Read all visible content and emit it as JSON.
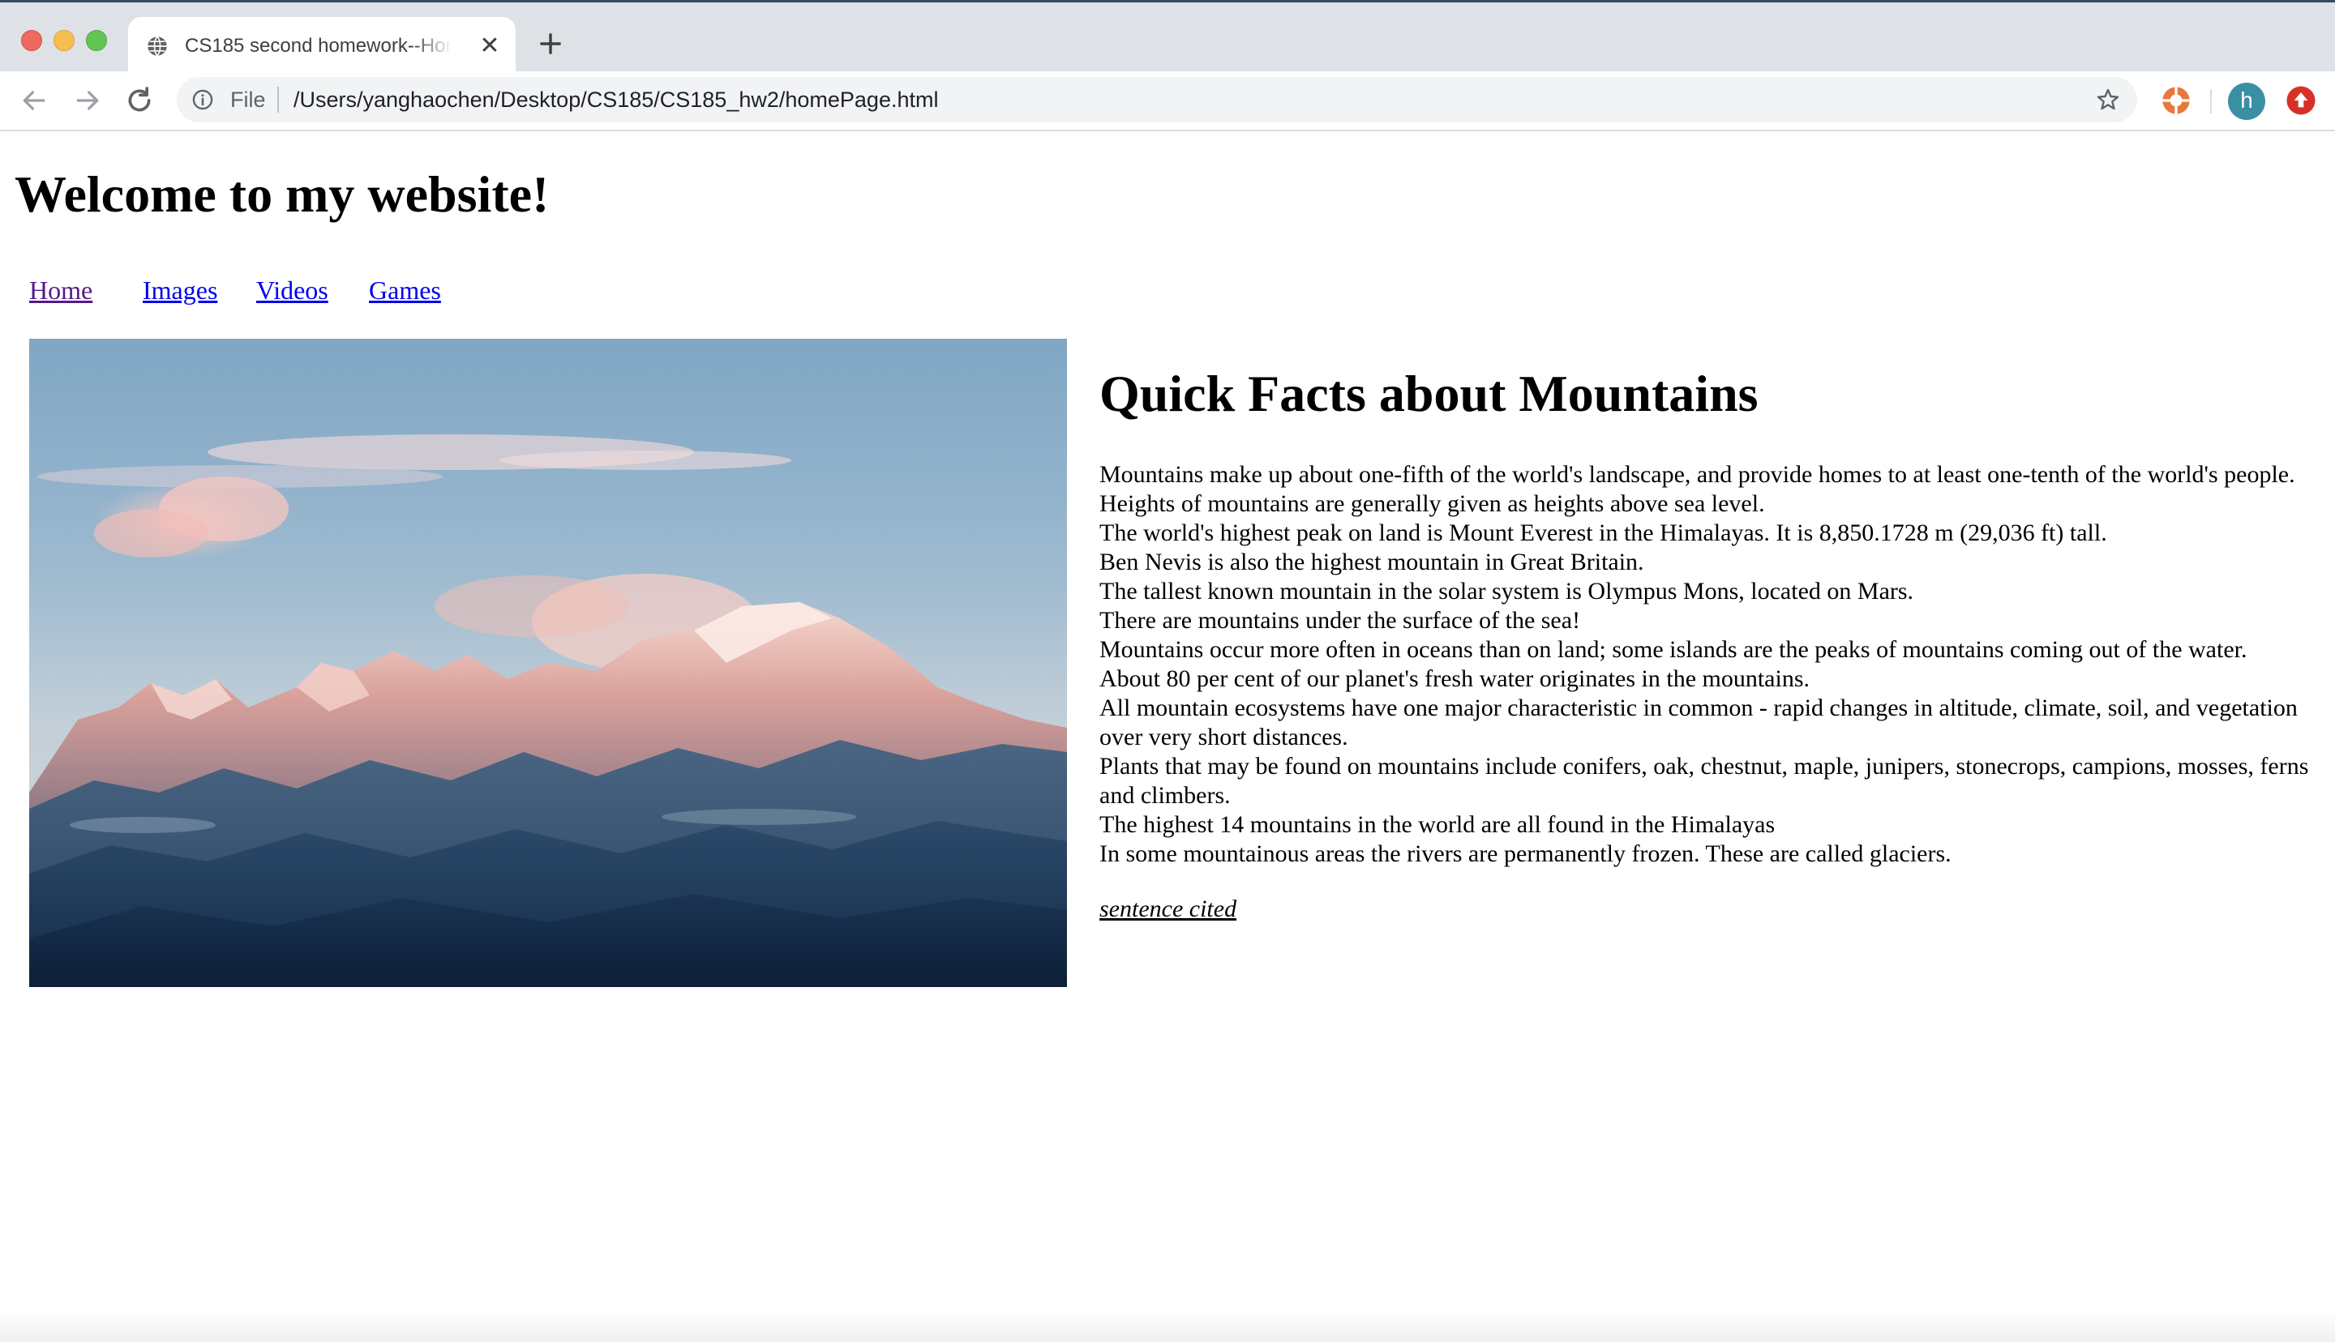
{
  "browser": {
    "window_controls": [
      "close",
      "minimize",
      "zoom"
    ],
    "tab": {
      "title": "CS185 second homework--Home",
      "favicon": "globe-icon",
      "close_icon": "close-icon"
    },
    "new_tab_icon": "plus-icon",
    "toolbar": {
      "back_icon": "arrow-left-icon",
      "forward_icon": "arrow-right-icon",
      "reload_icon": "reload-icon",
      "info_icon": "info-icon",
      "scheme_label": "File",
      "url": "/Users/yanghaochen/Desktop/CS185/CS185_hw2/homePage.html",
      "bookmark_icon": "star-icon",
      "extension_icon": "extension-icon",
      "profile_initial": "h",
      "update_icon": "update-icon"
    },
    "colors": {
      "tabstrip": "#dee1e6",
      "omnibox": "#f1f3f4",
      "avatar": "#3b8fa4",
      "extension": "#e8793a",
      "update": "#d93025"
    }
  },
  "page": {
    "title": "Welcome to my website!",
    "nav": [
      {
        "label": "Home",
        "visited": true
      },
      {
        "label": "Images",
        "visited": false
      },
      {
        "label": "Videos",
        "visited": false
      },
      {
        "label": "Games",
        "visited": false
      }
    ],
    "hero_image": "mountain-range-photo",
    "facts": {
      "heading": "Quick Facts about Mountains",
      "lines": [
        "Mountains make up about one-fifth of the world's landscape, and provide homes to at least one-tenth of the world's people.",
        "Heights of mountains are generally given as heights above sea level.",
        "The world's highest peak on land is Mount Everest in the Himalayas. It is 8,850.1728 m (29,036 ft) tall.",
        "Ben Nevis is also the highest mountain in Great Britain.",
        "The tallest known mountain in the solar system is Olympus Mons, located on Mars.",
        "There are mountains under the surface of the sea!",
        "Mountains occur more often in oceans than on land; some islands are the peaks of mountains coming out of the water.",
        "About 80 per cent of our planet's fresh water originates in the mountains.",
        "All mountain ecosystems have one major characteristic in common - rapid changes in altitude, climate, soil, and vegetation over very short distances.",
        "Plants that may be found on mountains include conifers, oak, chestnut, maple, junipers, stonecrops, campions, mosses, ferns and climbers.",
        "The highest 14 mountains in the world are all found in the Himalayas",
        "In some mountainous areas the rivers are permanently frozen. These are called glaciers."
      ],
      "citation_link": "sentence cited"
    },
    "link_colors": {
      "visited": "#551a8b",
      "unvisited": "#0000ee"
    }
  }
}
